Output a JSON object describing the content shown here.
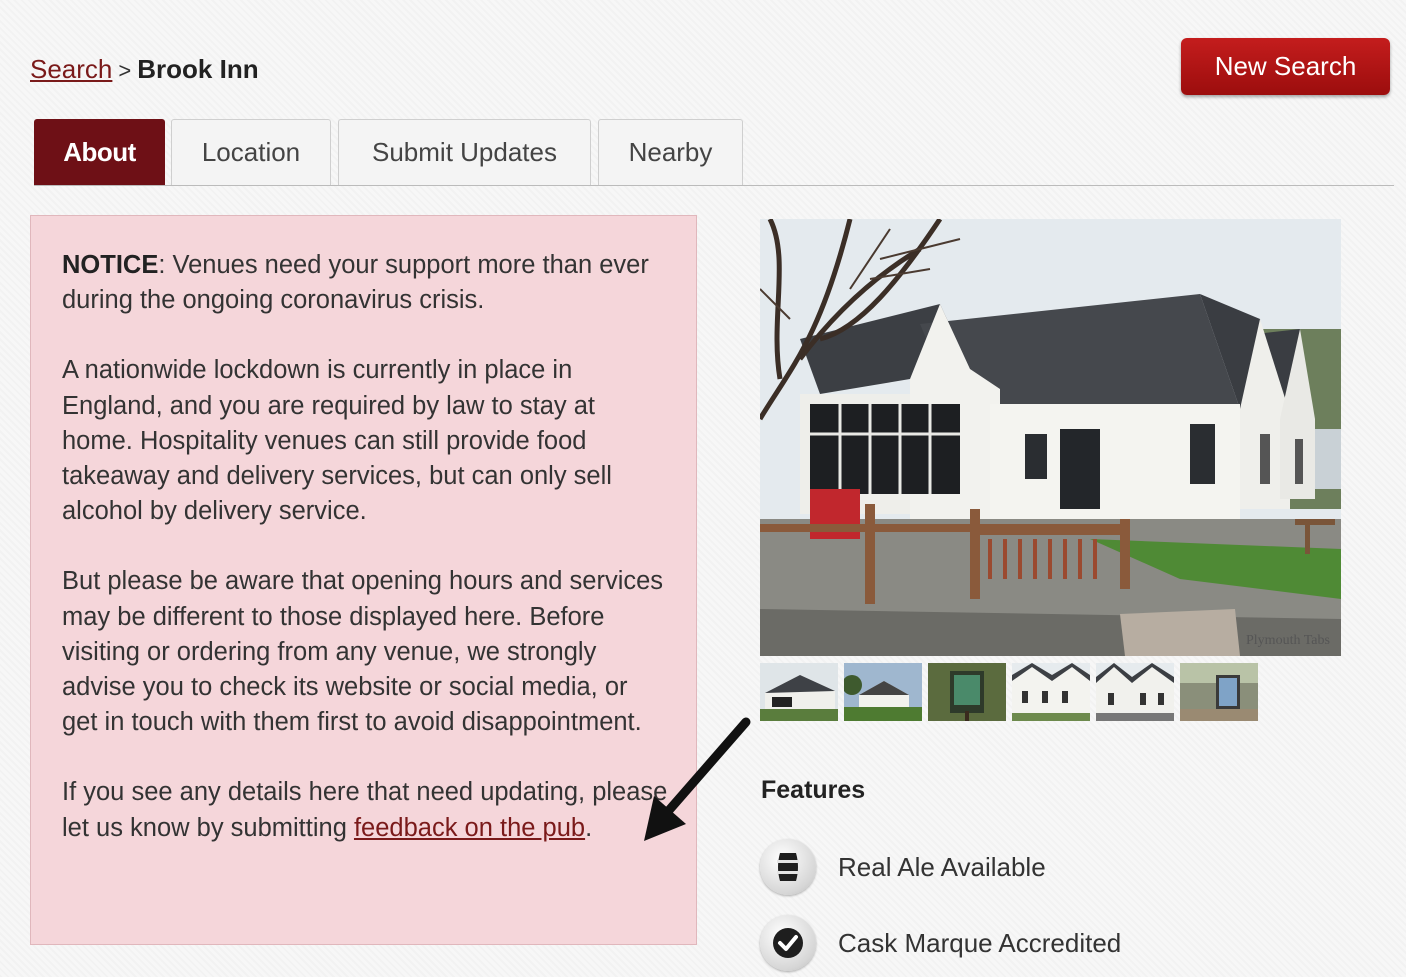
{
  "breadcrumb": {
    "link": "Search",
    "separator": ">",
    "current": "Brook Inn"
  },
  "header": {
    "new_search_label": "New Search"
  },
  "tabs": [
    {
      "label": "About"
    },
    {
      "label": "Location"
    },
    {
      "label": "Submit Updates"
    },
    {
      "label": "Nearby"
    }
  ],
  "notice": {
    "heading": "NOTICE",
    "intro": ": Venues need your support more than ever during the ongoing coronavirus crisis.",
    "para2": "A nationwide lockdown is currently in place in England, and you are required by law to stay at home. Hospitality venues can still provide food takeaway and delivery services, but can only sell alcohol by delivery service.",
    "para3": "But please be aware that opening hours and services may be different to those displayed here. Before visiting or ordering from any venue, we strongly advise you to check its website or social media, or get in touch with them first to avoid disappointment.",
    "para4_prefix": "If you see any details here that need updating, please let us know by submitting ",
    "feedback_link": "feedback on the pub",
    "para4_suffix": "."
  },
  "photo": {
    "watermark": "Plymouth Tabs"
  },
  "features": {
    "title": "Features",
    "items": [
      {
        "label": "Real Ale Available",
        "icon": "barrel-icon"
      },
      {
        "label": "Cask Marque Accredited",
        "icon": "checkmark-icon"
      }
    ]
  },
  "colors": {
    "accent": "#6e1016",
    "button": "#b01515",
    "notice_bg": "#f5d6da",
    "link": "#7a1a1a"
  }
}
